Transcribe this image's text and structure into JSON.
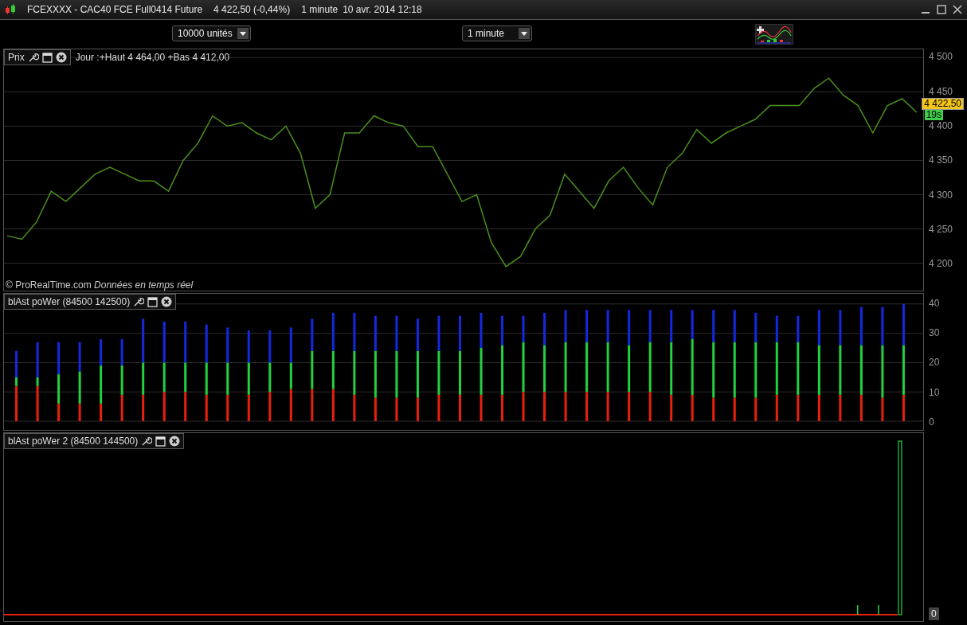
{
  "window": {
    "title": "FCEXXXX - CAC40 FCE Full0414 Future",
    "quote": "4 422,50 (-0,44%)",
    "interval": "1 minute",
    "datetime": "10 avr. 2014 12:18"
  },
  "toolbar": {
    "units_dropdown": "10000 unités",
    "interval_dropdown": "1 minute"
  },
  "price_panel": {
    "label": "Prix",
    "day_range": "Jour :+Haut 4 464,00 +Bas 4 412,00",
    "source": "© ProRealTime.com *Données en temps réel*",
    "last_price": "4 422,50",
    "countdown": "19s",
    "chart_data": {
      "type": "line",
      "grid": true,
      "ylim": [
        4160,
        4512
      ],
      "yticks": [
        {
          "value": 4200,
          "label": "4 200"
        },
        {
          "value": 4250,
          "label": "4 250"
        },
        {
          "value": 4300,
          "label": "4 300"
        },
        {
          "value": 4350,
          "label": "4 350"
        },
        {
          "value": 4400,
          "label": "4 400"
        },
        {
          "value": 4450,
          "label": "4 450"
        },
        {
          "value": 4500,
          "label": "4 500"
        }
      ],
      "series": [
        {
          "color": "#4a8f1c",
          "values": [
            4240,
            4235,
            4260,
            4305,
            4290,
            4310,
            4330,
            4340,
            4330,
            4320,
            4320,
            4305,
            4350,
            4375,
            4415,
            4400,
            4405,
            4390,
            4380,
            4400,
            4360,
            4280,
            4300,
            4390,
            4390,
            4415,
            4405,
            4400,
            4370,
            4370,
            4330,
            4290,
            4300,
            4230,
            4195,
            4210,
            4250,
            4270,
            4330,
            4305,
            4280,
            4320,
            4340,
            4310,
            4285,
            4340,
            4360,
            4395,
            4375,
            4390,
            4400,
            4410,
            4430,
            4430,
            4430,
            4455,
            4470,
            4445,
            4430,
            4390,
            4430,
            4440,
            4420
          ]
        }
      ]
    }
  },
  "blast_panel": {
    "label": "blAst poWer (84500 142500)",
    "chart_data": {
      "type": "bar",
      "stacked": true,
      "grid": true,
      "ylim": [
        -3,
        43.5
      ],
      "yticks": [
        0,
        10,
        20,
        30,
        40
      ],
      "series": [
        {
          "color": "#e8200c",
          "values": [
            12,
            12,
            6,
            6,
            6,
            9,
            9,
            10,
            10,
            9,
            9,
            9,
            10,
            11,
            11,
            11,
            9,
            8,
            8,
            8,
            9,
            9,
            9,
            9,
            10,
            10,
            10,
            10,
            10,
            10,
            10,
            9,
            9,
            8,
            8,
            8,
            9,
            9,
            9,
            9,
            9,
            8,
            9
          ]
        },
        {
          "color": "#22d040",
          "values": [
            3,
            3,
            10,
            11,
            13,
            10,
            11,
            10,
            10,
            11,
            11,
            11,
            10,
            9,
            13,
            13,
            15,
            16,
            16,
            16,
            15,
            15,
            16,
            17,
            17,
            16,
            17,
            17,
            17,
            16,
            17,
            18,
            19,
            19,
            19,
            19,
            18,
            18,
            17,
            17,
            17,
            18,
            17
          ]
        },
        {
          "color": "#1428e0",
          "values": [
            9,
            12,
            11,
            10,
            9,
            9,
            15,
            14,
            14,
            13,
            12,
            11,
            11,
            12,
            11,
            13,
            13,
            12,
            12,
            11,
            12,
            12,
            12,
            10,
            9,
            11,
            11,
            11,
            11,
            12,
            11,
            11,
            10,
            11,
            11,
            10,
            9,
            9,
            12,
            12,
            13,
            13,
            14
          ]
        }
      ]
    }
  },
  "blast2_panel": {
    "label": "blAst poWer 2 (84500 144500)",
    "axis_label": "0"
  }
}
